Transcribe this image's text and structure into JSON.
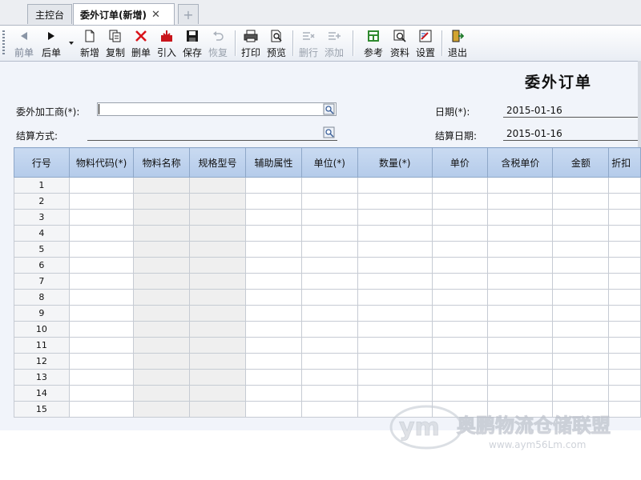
{
  "tabs": {
    "home": "主控台",
    "active": "委外订单(新增)",
    "close": "✕",
    "add": "+"
  },
  "toolbar": {
    "prev": "前单",
    "next": "后单",
    "new": "新增",
    "copy": "复制",
    "delete": "删单",
    "import": "引入",
    "save": "保存",
    "restore": "恢复",
    "print": "打印",
    "preview": "预览",
    "delete_row": "删行",
    "add_row": "添加",
    "reference": "参考",
    "material": "资料",
    "settings": "设置",
    "exit": "退出"
  },
  "form": {
    "title": "委外订单",
    "processor_label": "委外加工商(*):",
    "processor_value": "",
    "date_label": "日期(*):",
    "date_value": "2015-01-16",
    "settle_method_label": "结算方式:",
    "settle_date_label": "结算日期:",
    "settle_date_value": "2015-01-16"
  },
  "grid": {
    "columns": [
      "行号",
      "物料代码(*)",
      "物料名称",
      "规格型号",
      "辅助属性",
      "单位(*)",
      "数量(*)",
      "单价",
      "含税单价",
      "金额",
      "折扣"
    ],
    "rows": [
      "1",
      "2",
      "3",
      "4",
      "5",
      "6",
      "7",
      "8",
      "9",
      "10",
      "11",
      "12",
      "13",
      "14",
      "15"
    ]
  },
  "watermark": {
    "text": "奥鹏物流仓储联盟",
    "url": "www.aym56Lm.com"
  },
  "colors": {
    "header_blue": "#b4cbea",
    "delete_red": "#d9141b",
    "import_red": "#c8141b"
  },
  "icons": {
    "prev": "arrow-left-icon",
    "next": "arrow-right-icon",
    "new": "new-document-icon",
    "copy": "copy-icon",
    "delete": "red-x-icon",
    "import": "import-icon",
    "save": "floppy-disk-icon",
    "restore": "undo-icon",
    "print": "printer-icon",
    "preview": "magnifier-page-icon",
    "delete_row": "delete-row-icon",
    "add_row": "add-row-icon",
    "reference": "grid-reference-icon",
    "material": "search-data-icon",
    "settings": "settings-form-icon",
    "exit": "exit-door-icon"
  }
}
